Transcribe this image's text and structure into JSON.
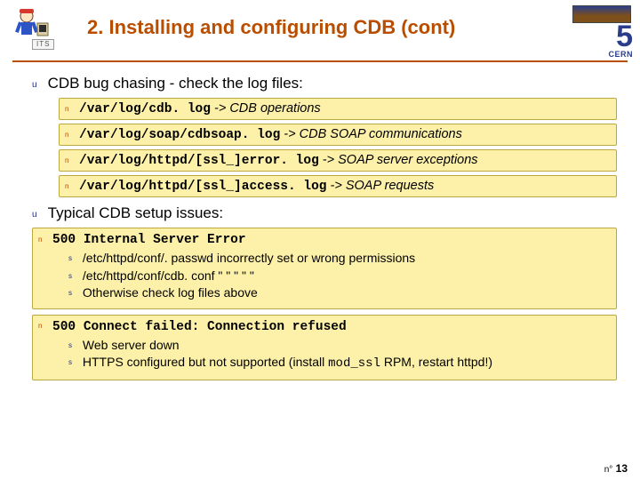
{
  "header": {
    "its_label": "ITS",
    "title": "2. Installing and configuring CDB (cont)",
    "logo_text": "5",
    "logo_sub": "CERN"
  },
  "bullets": {
    "b1": {
      "text": "CDB bug chasing - check the log files:",
      "items": [
        {
          "mono": "/var/log/cdb. log",
          "rest": " -> CDB operations"
        },
        {
          "mono": "/var/log/soap/cdbsoap. log",
          "rest": " -> CDB SOAP communications"
        },
        {
          "mono": "/var/log/httpd/[ssl_]error. log",
          "rest": " -> SOAP server exceptions"
        },
        {
          "mono": "/var/log/httpd/[ssl_]access. log",
          "rest": " -> SOAP requests"
        }
      ]
    },
    "b2": {
      "text": "Typical CDB setup issues:",
      "g1": {
        "head": "500 Internal Server Error",
        "items": [
          "/etc/httpd/conf/. passwd incorrectly set or wrong permissions",
          "/etc/httpd/conf/cdb. conf   \"               \"   \"    \"            \"",
          "Otherwise check log files above"
        ]
      },
      "g2": {
        "head": "500 Connect failed: Connection refused",
        "items": [
          "Web server down",
          "HTTPS configured but not supported (install mod_ssl RPM, restart httpd!)"
        ],
        "mod_ssl": "mod_ssl"
      }
    }
  },
  "footer": {
    "no_label": "n°",
    "num": "13"
  }
}
